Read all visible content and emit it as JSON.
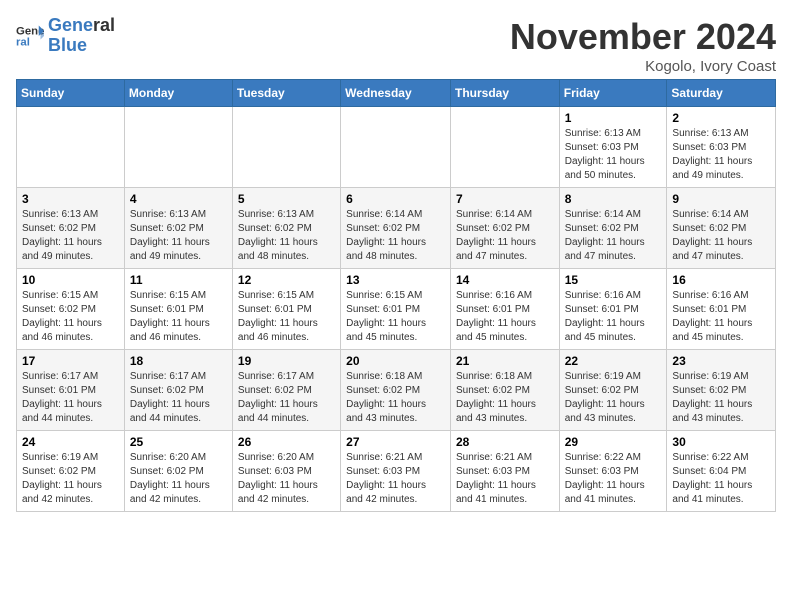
{
  "header": {
    "logo_line1": "General",
    "logo_line2": "Blue",
    "month_title": "November 2024",
    "location": "Kogolo, Ivory Coast"
  },
  "weekdays": [
    "Sunday",
    "Monday",
    "Tuesday",
    "Wednesday",
    "Thursday",
    "Friday",
    "Saturday"
  ],
  "weeks": [
    [
      {
        "day": "",
        "info": ""
      },
      {
        "day": "",
        "info": ""
      },
      {
        "day": "",
        "info": ""
      },
      {
        "day": "",
        "info": ""
      },
      {
        "day": "",
        "info": ""
      },
      {
        "day": "1",
        "info": "Sunrise: 6:13 AM\nSunset: 6:03 PM\nDaylight: 11 hours and 50 minutes."
      },
      {
        "day": "2",
        "info": "Sunrise: 6:13 AM\nSunset: 6:03 PM\nDaylight: 11 hours and 49 minutes."
      }
    ],
    [
      {
        "day": "3",
        "info": "Sunrise: 6:13 AM\nSunset: 6:02 PM\nDaylight: 11 hours and 49 minutes."
      },
      {
        "day": "4",
        "info": "Sunrise: 6:13 AM\nSunset: 6:02 PM\nDaylight: 11 hours and 49 minutes."
      },
      {
        "day": "5",
        "info": "Sunrise: 6:13 AM\nSunset: 6:02 PM\nDaylight: 11 hours and 48 minutes."
      },
      {
        "day": "6",
        "info": "Sunrise: 6:14 AM\nSunset: 6:02 PM\nDaylight: 11 hours and 48 minutes."
      },
      {
        "day": "7",
        "info": "Sunrise: 6:14 AM\nSunset: 6:02 PM\nDaylight: 11 hours and 47 minutes."
      },
      {
        "day": "8",
        "info": "Sunrise: 6:14 AM\nSunset: 6:02 PM\nDaylight: 11 hours and 47 minutes."
      },
      {
        "day": "9",
        "info": "Sunrise: 6:14 AM\nSunset: 6:02 PM\nDaylight: 11 hours and 47 minutes."
      }
    ],
    [
      {
        "day": "10",
        "info": "Sunrise: 6:15 AM\nSunset: 6:02 PM\nDaylight: 11 hours and 46 minutes."
      },
      {
        "day": "11",
        "info": "Sunrise: 6:15 AM\nSunset: 6:01 PM\nDaylight: 11 hours and 46 minutes."
      },
      {
        "day": "12",
        "info": "Sunrise: 6:15 AM\nSunset: 6:01 PM\nDaylight: 11 hours and 46 minutes."
      },
      {
        "day": "13",
        "info": "Sunrise: 6:15 AM\nSunset: 6:01 PM\nDaylight: 11 hours and 45 minutes."
      },
      {
        "day": "14",
        "info": "Sunrise: 6:16 AM\nSunset: 6:01 PM\nDaylight: 11 hours and 45 minutes."
      },
      {
        "day": "15",
        "info": "Sunrise: 6:16 AM\nSunset: 6:01 PM\nDaylight: 11 hours and 45 minutes."
      },
      {
        "day": "16",
        "info": "Sunrise: 6:16 AM\nSunset: 6:01 PM\nDaylight: 11 hours and 45 minutes."
      }
    ],
    [
      {
        "day": "17",
        "info": "Sunrise: 6:17 AM\nSunset: 6:01 PM\nDaylight: 11 hours and 44 minutes."
      },
      {
        "day": "18",
        "info": "Sunrise: 6:17 AM\nSunset: 6:02 PM\nDaylight: 11 hours and 44 minutes."
      },
      {
        "day": "19",
        "info": "Sunrise: 6:17 AM\nSunset: 6:02 PM\nDaylight: 11 hours and 44 minutes."
      },
      {
        "day": "20",
        "info": "Sunrise: 6:18 AM\nSunset: 6:02 PM\nDaylight: 11 hours and 43 minutes."
      },
      {
        "day": "21",
        "info": "Sunrise: 6:18 AM\nSunset: 6:02 PM\nDaylight: 11 hours and 43 minutes."
      },
      {
        "day": "22",
        "info": "Sunrise: 6:19 AM\nSunset: 6:02 PM\nDaylight: 11 hours and 43 minutes."
      },
      {
        "day": "23",
        "info": "Sunrise: 6:19 AM\nSunset: 6:02 PM\nDaylight: 11 hours and 43 minutes."
      }
    ],
    [
      {
        "day": "24",
        "info": "Sunrise: 6:19 AM\nSunset: 6:02 PM\nDaylight: 11 hours and 42 minutes."
      },
      {
        "day": "25",
        "info": "Sunrise: 6:20 AM\nSunset: 6:02 PM\nDaylight: 11 hours and 42 minutes."
      },
      {
        "day": "26",
        "info": "Sunrise: 6:20 AM\nSunset: 6:03 PM\nDaylight: 11 hours and 42 minutes."
      },
      {
        "day": "27",
        "info": "Sunrise: 6:21 AM\nSunset: 6:03 PM\nDaylight: 11 hours and 42 minutes."
      },
      {
        "day": "28",
        "info": "Sunrise: 6:21 AM\nSunset: 6:03 PM\nDaylight: 11 hours and 41 minutes."
      },
      {
        "day": "29",
        "info": "Sunrise: 6:22 AM\nSunset: 6:03 PM\nDaylight: 11 hours and 41 minutes."
      },
      {
        "day": "30",
        "info": "Sunrise: 6:22 AM\nSunset: 6:04 PM\nDaylight: 11 hours and 41 minutes."
      }
    ]
  ]
}
